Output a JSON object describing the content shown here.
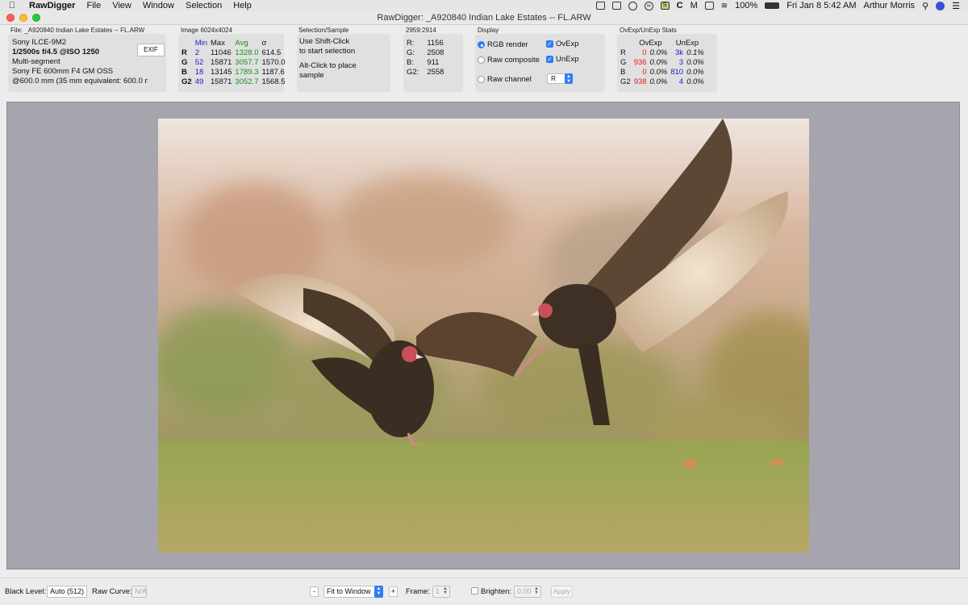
{
  "menubar": {
    "app": "RawDigger",
    "menus": [
      "File",
      "View",
      "Window",
      "Selection",
      "Help"
    ],
    "battery": "100%",
    "clock": "Fri Jan 8  5:42 AM",
    "user": "Arthur Morris"
  },
  "window": {
    "title": "RawDigger: _A920840  Indian Lake Estates -- FL.ARW"
  },
  "file_panel": {
    "label": "File: _A920840  Indian Lake Estates -- FL.ARW",
    "camera": "Sony ILCE-9M2",
    "exposure": "1/2500s f/4.5 @ISO 1250",
    "metering": "Multi-segment",
    "lens": "Sony FE 600mm F4 GM OSS",
    "focal": "@600.0 mm (35 mm equivalent: 600.0 mm)",
    "exif_button": "EXIF"
  },
  "image_panel": {
    "label": "Image 6024x4024",
    "headers": {
      "min": "Min",
      "max": "Max",
      "avg": "Avg",
      "sigma": "σ"
    },
    "rows": [
      {
        "ch": "R",
        "min": "2",
        "max": "11046",
        "avg": "1328.0",
        "sigma": "614.5"
      },
      {
        "ch": "G",
        "min": "52",
        "max": "15871",
        "avg": "3057.7",
        "sigma": "1570.0"
      },
      {
        "ch": "B",
        "min": "18",
        "max": "13145",
        "avg": "1789.3",
        "sigma": "1187.6"
      },
      {
        "ch": "G2",
        "min": "49",
        "max": "15871",
        "avg": "3052.7",
        "sigma": "1568.5"
      }
    ]
  },
  "selection_panel": {
    "label": "Selection/Sample",
    "line1": "Use Shift-Click",
    "line2": "to start selection",
    "line3": "Alt-Click to place",
    "line4": "sample"
  },
  "sample_panel": {
    "label": "2959:2914",
    "rows": [
      {
        "ch": "R:",
        "value": "1156"
      },
      {
        "ch": "G:",
        "value": "2508"
      },
      {
        "ch": "B:",
        "value": "911"
      },
      {
        "ch": "G2:",
        "value": "2558"
      }
    ]
  },
  "display_panel": {
    "label": "Display",
    "rgb_render": "RGB render",
    "raw_composite": "Raw composite",
    "raw_channel": "Raw channel",
    "ovexp": "OvExp",
    "unexp": "UnExp",
    "channel_value": "R"
  },
  "ovexp_panel": {
    "label": "OvExp/UnExp Stats",
    "headers": {
      "ovexp": "OvExp",
      "unexp": "UnExp"
    },
    "rows": [
      {
        "ch": "R",
        "ov": "0",
        "ov_pct": "0.0%",
        "un": "3k",
        "un_pct": "0.1%"
      },
      {
        "ch": "G",
        "ov": "936",
        "ov_pct": "0.0%",
        "un": "3",
        "un_pct": "0.0%"
      },
      {
        "ch": "B",
        "ov": "0",
        "ov_pct": "0.0%",
        "un": "810",
        "un_pct": "0.0%"
      },
      {
        "ch": "G2",
        "ov": "938",
        "ov_pct": "0.0%",
        "un": "4",
        "un_pct": "0.0%"
      }
    ]
  },
  "bottombar": {
    "black_level_label": "Black Level:",
    "black_level_value": "Auto (512)",
    "raw_curve_label": "Raw Curve:",
    "raw_curve_value": "N/A",
    "zoom_minus": "-",
    "zoom_value": "Fit to Window",
    "zoom_plus": "+",
    "frame_label": "Frame:",
    "frame_value": "1",
    "brighten_label": "Brighten:",
    "brighten_value": "0.00",
    "apply_label": "Apply"
  },
  "colors": {
    "blue_text": "#1a1ad0",
    "green_text": "#18901e",
    "red_text": "#e2191c",
    "accent": "#2f7cf6",
    "viewer_bg": "#a6a5ad"
  }
}
